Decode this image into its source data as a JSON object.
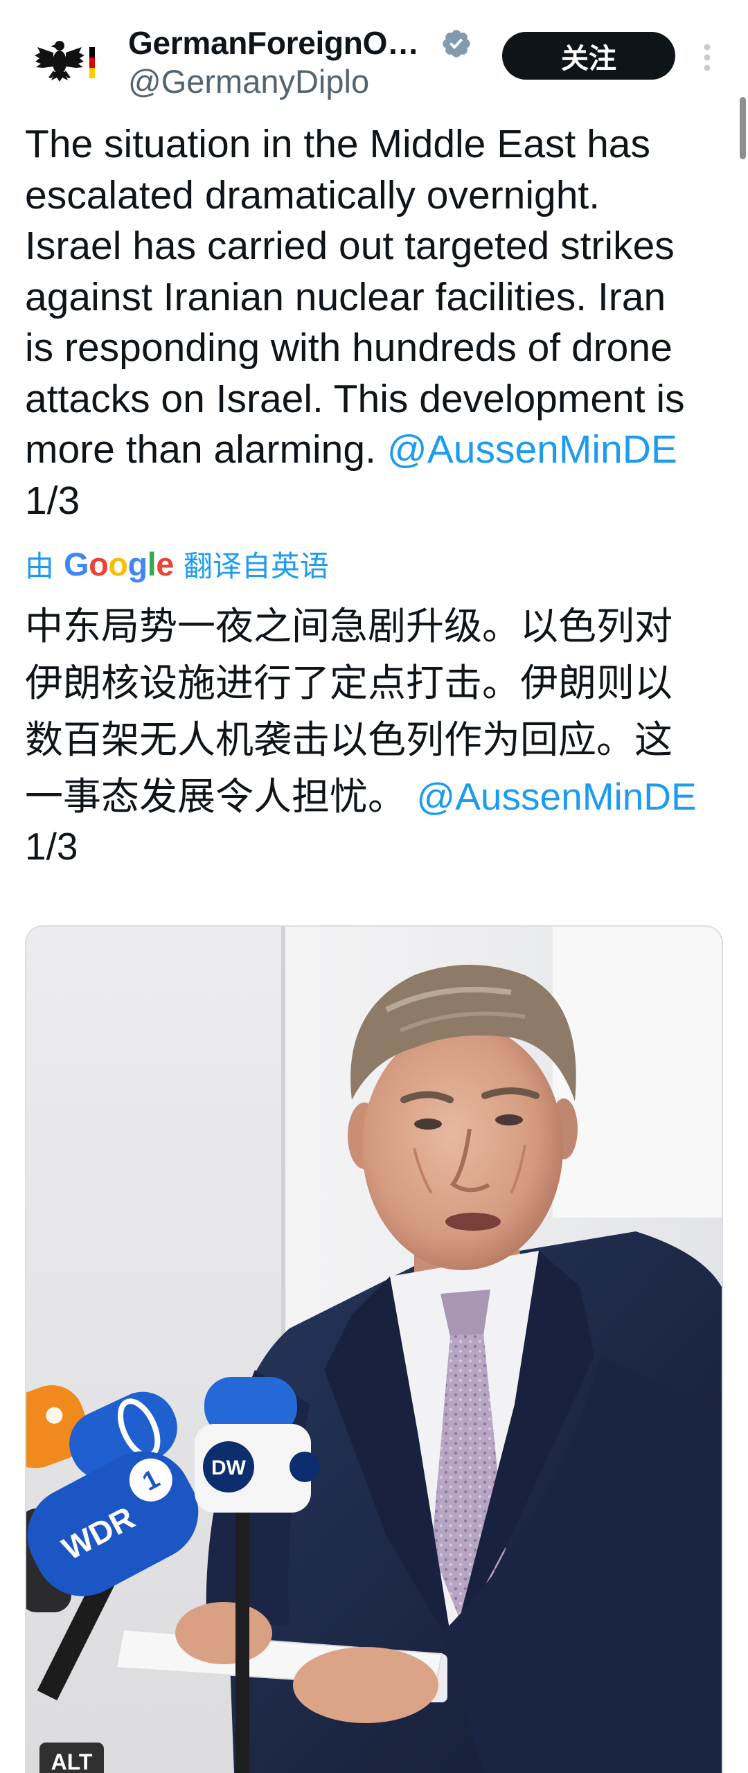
{
  "header": {
    "display_name": "GermanForeignO…",
    "handle": "@GermanyDiplo",
    "follow_label": "关注",
    "avatar_icon": "german-eagle-icon",
    "verified_icon": "verified-badge-icon",
    "more_icon": "more-vertical-icon"
  },
  "tweet": {
    "lines": [
      "The situation in the Middle East has",
      "escalated dramatically overnight.",
      "Israel has carried out targeted strikes",
      "against Iranian nuclear facilities. Iran",
      "is responding with hundreds of drone",
      "attacks on Israel. This development is",
      "more than alarming."
    ],
    "mention": "@AussenMinDE",
    "counter": "1/3"
  },
  "translation": {
    "prefix": "由",
    "brand": "Google",
    "suffix": "翻译自英语",
    "lines": [
      "中东局势一夜之间急剧升级。以色列对",
      "伊朗核设施进行了定点打击。伊朗则以",
      "数百架无人机袭击以色列作为回应。这",
      "一事态发展令人担忧。"
    ],
    "mention": "@AussenMinDE",
    "counter": "1/3"
  },
  "media": {
    "alt_label": "ALT",
    "mic_logos": {
      "dw": "DW",
      "wdr": "WDR",
      "ard": "1"
    }
  },
  "colors": {
    "accent": "#1d9bf0",
    "text": "#0f1419",
    "secondary": "#536471",
    "button_bg": "#0f1419",
    "badge": "#829aab"
  }
}
